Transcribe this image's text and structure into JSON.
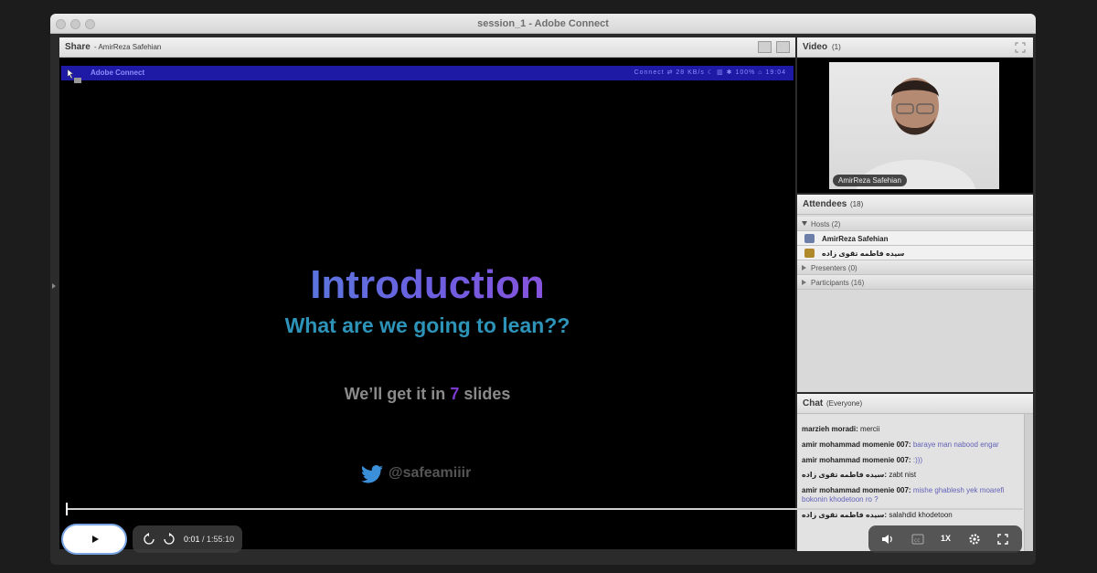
{
  "window": {
    "title": "session_1 - Adobe Connect"
  },
  "share_pod": {
    "title": "Share",
    "presenter": "- AmirReza Safehian",
    "menubar": {
      "app_name": "Adobe Connect",
      "right_text": "Connect   ⇄   28 KB/s   ☾   ▥   ✱   100%   ⌂   19:04"
    },
    "slide": {
      "title": "Introduction",
      "subtitle": "What are we going to lean??",
      "note_before": "We’ll get it in ",
      "note_accent": "7",
      "note_after": " slides",
      "twitter_handle": "@safeamiiir"
    }
  },
  "video_pod": {
    "title": "Video",
    "count": "(1)",
    "participant_name": "AmirReza Safehian"
  },
  "attendees_pod": {
    "title": "Attendees",
    "count": "(18)",
    "hosts_label": "Hosts (2)",
    "hosts": [
      "AmirReza Safehian",
      "سیده فاطمه تقوی زاده"
    ],
    "presenters_label": "Presenters (0)",
    "participants_label": "Participants (16)"
  },
  "chat_pod": {
    "title": "Chat",
    "scope": "(Everyone)",
    "messages": [
      {
        "who": "marzieh moradi:",
        "msg": "mercii",
        "plain": true
      },
      {
        "who": "amir mohammad momenie 007:",
        "msg": "baraye man nabood engar",
        "plain": false
      },
      {
        "who": "amir mohammad momenie 007:",
        "msg": ":)))",
        "plain": false
      },
      {
        "who": "سیده فاطمه تقوی زاده:",
        "msg": "zabt nist",
        "plain": true
      },
      {
        "who": "amir mohammad momenie 007:",
        "msg": "mishe ghablesh yek moarefi bokonin khodetoon ro ?",
        "plain": false
      },
      {
        "who": "سیده فاطمه تقوی زاده:",
        "msg": "salahdid khodetoon",
        "plain": true
      }
    ]
  },
  "player": {
    "current_time": "0:01",
    "total_time": "/ 1:55:10",
    "playback_rate": "1X",
    "progress_fraction": 0.0
  }
}
